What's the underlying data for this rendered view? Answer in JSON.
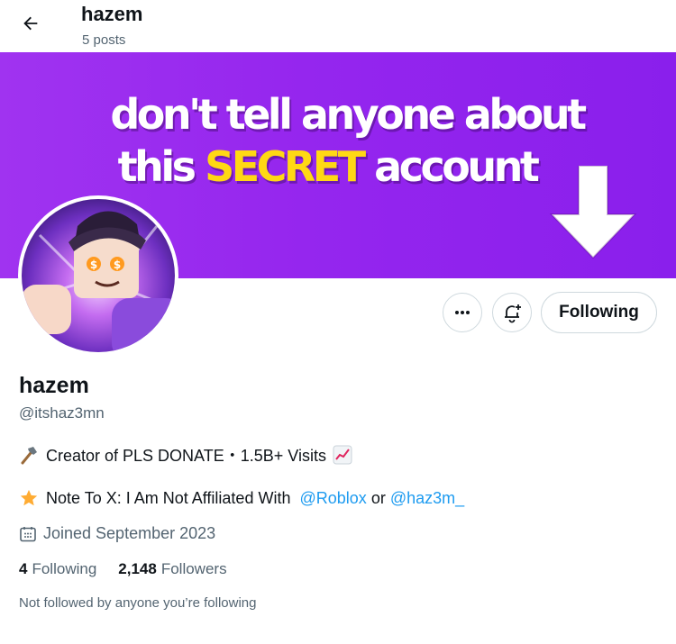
{
  "header": {
    "name": "hazem",
    "post_count": "5 posts"
  },
  "banner": {
    "line1": "don't tell anyone about",
    "line2_before": "this ",
    "line2_highlight": "SECRET",
    "line2_after": " account",
    "background_color": "#9526ee",
    "highlight_color": "#ffd814"
  },
  "actions": {
    "more_icon": "more-horizontal-icon",
    "notify_icon": "bell-plus-icon",
    "follow_label": "Following"
  },
  "profile": {
    "display_name": "hazem",
    "handle": "@itshaz3mn",
    "bio_line1": "Creator of PLS DONATE・1.5B+ Visits",
    "bio_line2_text": "Note To X: I Am Not Affiliated With",
    "mention1": "@Roblox",
    "or_word": "or",
    "mention2": "@haz3m_",
    "joined": "Joined September 2023",
    "following_count": "4",
    "following_label": "Following",
    "followers_count": "2,148",
    "followers_label": "Followers",
    "mutual_note": "Not followed by anyone you’re following"
  },
  "colors": {
    "accent": "#1d9bf0",
    "secondary_text": "#536471",
    "border": "#cfd9de"
  }
}
